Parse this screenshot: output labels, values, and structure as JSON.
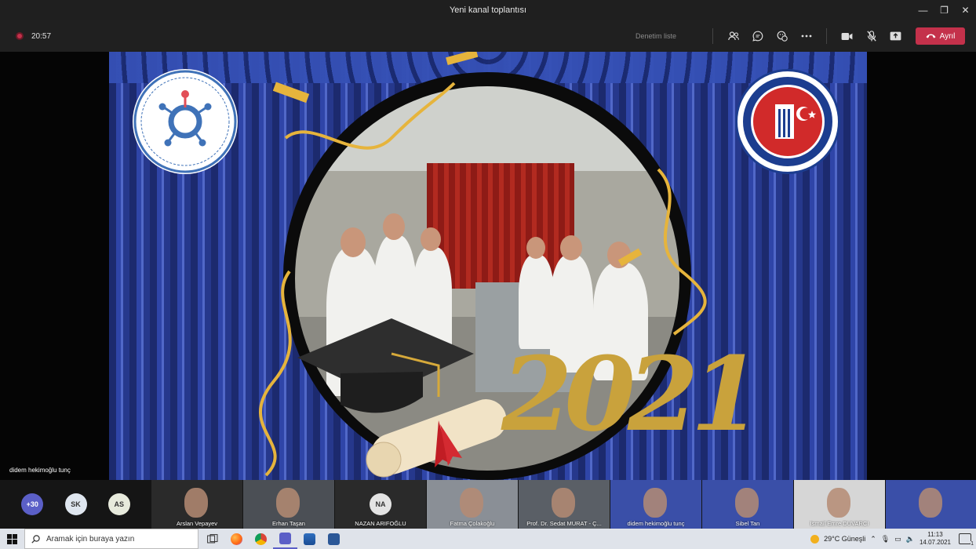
{
  "window": {
    "title": "Yeni kanal toplantısı",
    "minimize": "—",
    "maximize": "❐",
    "close": "✕"
  },
  "toolbar": {
    "timer": "20:57",
    "lobby_label": "Denetim liste",
    "leave_label": "Ayrıl"
  },
  "stage": {
    "speaker_name": "didem hekimoğlu tunç"
  },
  "gallery": {
    "overflow": [
      {
        "label": "+30",
        "color": "#5b5fc7",
        "text_color": "#ffffff"
      },
      {
        "label": "SK",
        "color": "#dfe6ef",
        "text_color": "#333333"
      },
      {
        "label": "AS",
        "color": "#e7eadc",
        "text_color": "#333333"
      }
    ],
    "tiles": [
      {
        "name": "Arslan Vepayev",
        "bg": "#2a2a2a"
      },
      {
        "name": "Erhan Taşan",
        "bg": "#4b4f55"
      },
      {
        "name": "NAZAN ARIFOĞLU",
        "initials": "NA",
        "bg": "#2a2a2a"
      },
      {
        "name": "Fatma Çolakoğlu",
        "bg": "#8a8f96"
      },
      {
        "name": "Prof. Dr. Sedat MURAT - Ç...",
        "bg": "#5a5f66"
      },
      {
        "name": "didem hekimoğlu tunç",
        "bg": "#3a4fa8"
      },
      {
        "name": "Sibel Tan",
        "bg": "#3a4fa8"
      },
      {
        "name": "İsmail Emre DUVARCI",
        "bg": "#d6d6d6"
      },
      {
        "name": "",
        "bg": "#3a4fa8"
      }
    ]
  },
  "taskbar": {
    "search_placeholder": "Aramak için buraya yazın",
    "weather": "29°C  Güneşli",
    "time": "11:13",
    "date": "14.07.2021",
    "notifications": "1"
  },
  "video_art": {
    "year_text": "2021"
  },
  "colors": {
    "accent": "#c4314b",
    "teams": "#5b5fc7"
  }
}
